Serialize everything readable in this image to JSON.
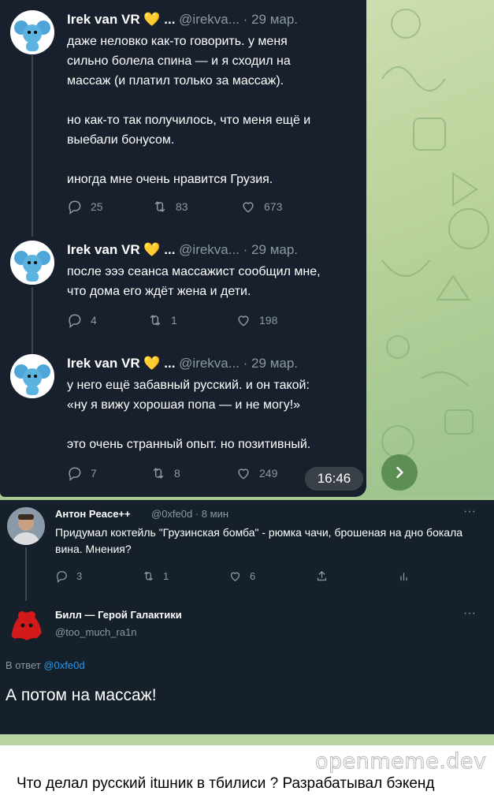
{
  "tweets": [
    {
      "author": "Irek van VR",
      "badge": "💛",
      "ellipsis": "...",
      "handle": "@irekva...",
      "date": "· 29 мар.",
      "text": "даже неловко как-то говорить. у меня\nсильно болела спина — и я сходил на\nмассаж (и платил только за массаж).\n\nно как-то так получилось, что меня ещё и\nвыебали бонусом.\n\nиногда мне очень нравится Грузия.",
      "replies": "25",
      "retweets": "83",
      "likes": "673"
    },
    {
      "author": "Irek van VR",
      "badge": "💛",
      "ellipsis": "...",
      "handle": "@irekva...",
      "date": "· 29 мар.",
      "text": "после эээ сеанса массажист сообщил мне,\nчто дома его ждёт жена и дети.",
      "replies": "4",
      "retweets": "1",
      "likes": "198"
    },
    {
      "author": "Irek van VR",
      "badge": "💛",
      "ellipsis": "...",
      "handle": "@irekva...",
      "date": "· 29 мар.",
      "text": "у него ещё забавный русский. и он такой:\n«ну я вижу хорошая попа — и не могу!»\n\nэто очень странный опыт. но позитивный.",
      "replies": "7",
      "retweets": "8",
      "likes": "249"
    }
  ],
  "message_time": "16:46",
  "thread2": {
    "first": {
      "author": "Антон Peace++",
      "handle": "@0xfe0d",
      "time": "· 8 мин",
      "text": "Придумал коктейль \"Грузинская бомба\" - рюмка чачи, брошеная на дно бокала вина. Мнения?",
      "replies": "3",
      "retweets": "1",
      "likes": "6",
      "more": "···"
    },
    "second": {
      "author": "Билл — Герой Галактики",
      "handle": "@too_much_ra1n",
      "more": "···",
      "reply_prefix": "В ответ",
      "reply_mention": "@0xfe0d",
      "text": "А потом на массаж!"
    }
  },
  "watermark": "openmeme.dev",
  "caption": "Что делал русский itшник в тбилиси ? Разрабатывал бэкенд",
  "colors": {
    "accent": "#1d9bf0",
    "tweet_bg": "#17202c",
    "time_badge": "#3a4048",
    "share_button": "#5d8f52"
  },
  "icons": [
    "reply-icon",
    "retweet-icon",
    "like-icon",
    "share-icon",
    "analytics-icon",
    "chevron-right-icon",
    "more-icon"
  ]
}
